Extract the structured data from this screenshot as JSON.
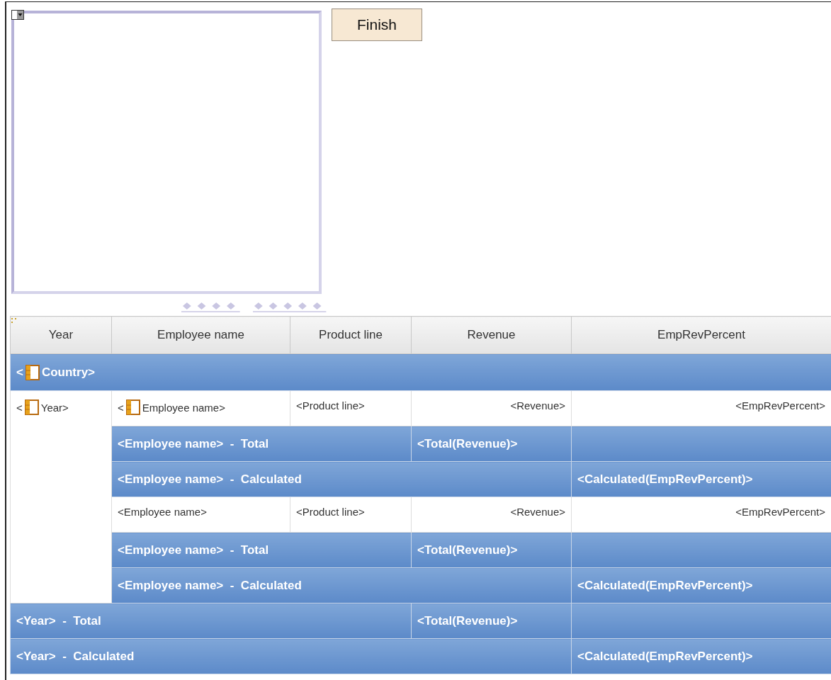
{
  "finish_button": {
    "label": "Finish"
  },
  "table": {
    "columns": [
      "Year",
      "Employee name",
      "Product line",
      "Revenue",
      "EmpRevPercent"
    ],
    "group": {
      "prefix": "<",
      "label": "Country>"
    },
    "year_group": {
      "year": {
        "prefix": "<",
        "text": "Year>"
      },
      "rows": [
        {
          "kind": "detail",
          "cells": [
            {
              "prefix": "<",
              "text": "Employee name>"
            },
            {
              "text": "<Product line>"
            },
            {
              "text": "<Revenue>"
            },
            {
              "text": "<EmpRevPercent>"
            }
          ]
        },
        {
          "kind": "total",
          "label": "<Employee name>  -  Total",
          "value": "<Total(Revenue)>"
        },
        {
          "kind": "calculated",
          "label": "<Employee name>  -  Calculated",
          "value": "<Calculated(EmpRevPercent)>"
        },
        {
          "kind": "detail",
          "cells": [
            {
              "text": "<Employee name>"
            },
            {
              "text": "<Product line>"
            },
            {
              "text": "<Revenue>"
            },
            {
              "text": "<EmpRevPercent>"
            }
          ]
        },
        {
          "kind": "total",
          "label": "<Employee name>  -  Total",
          "value": "<Total(Revenue)>"
        },
        {
          "kind": "calculated",
          "label": "<Employee name>  -  Calculated",
          "value": "<Calculated(EmpRevPercent)>"
        }
      ],
      "summaries": [
        {
          "kind": "total",
          "label": "<Year>  -  Total",
          "value": "<Total(Revenue)>"
        },
        {
          "kind": "calculated",
          "label": "<Year>  -  Calculated",
          "value": "<Calculated(EmpRevPercent)>"
        }
      ]
    }
  }
}
